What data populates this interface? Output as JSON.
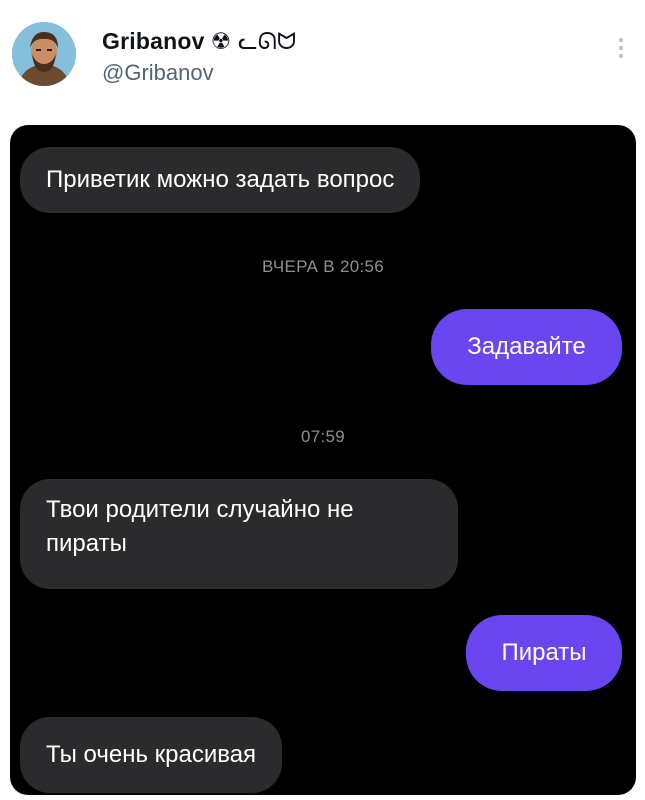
{
  "author": {
    "display_name": "Gribanov",
    "name_suffix": "☢ ᓚᘏᗢ",
    "handle": "@Gribanov"
  },
  "chat": {
    "messages": [
      {
        "side": "in",
        "text": "Приветик можно задать вопрос"
      },
      {
        "side": "timestamp",
        "text": "ВЧЕРА В 20:56"
      },
      {
        "side": "out",
        "text": "Задавайте"
      },
      {
        "side": "timestamp",
        "text": "07:59"
      },
      {
        "side": "in",
        "text": "Твои родители случайно не пираты"
      },
      {
        "side": "out",
        "text": "Пираты"
      },
      {
        "side": "in",
        "text": "Ты очень красивая"
      }
    ]
  },
  "colors": {
    "incoming_bubble": "#2b2b2d",
    "outgoing_bubble": "#6a46f0",
    "chat_background": "#000000"
  }
}
